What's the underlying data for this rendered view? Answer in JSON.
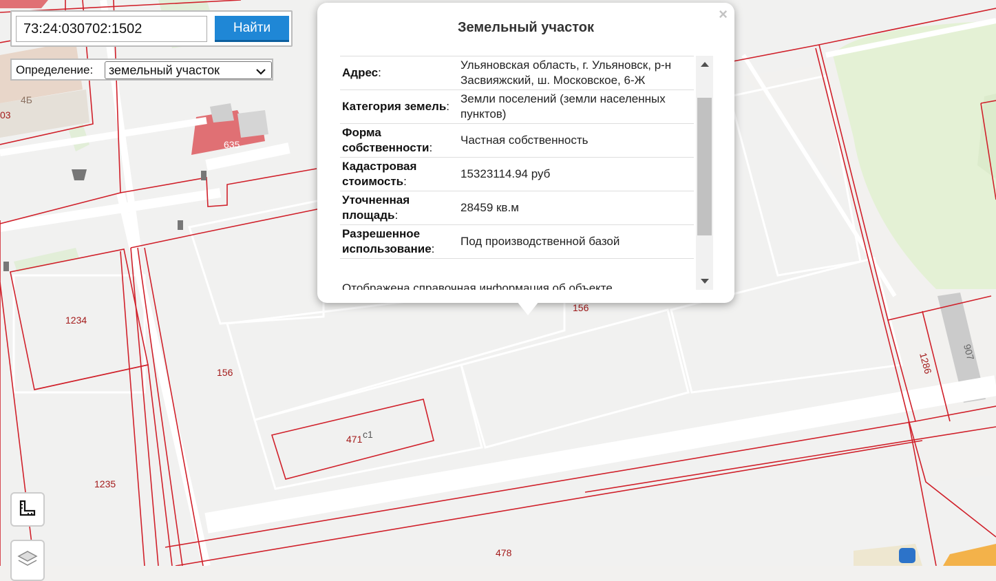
{
  "search": {
    "value": "73:24:030702:1502",
    "button_label": "Найти"
  },
  "definition": {
    "label": "Определение:",
    "selected": "земельный участок"
  },
  "map": {
    "labels": [
      "4Б",
      "03",
      "635",
      "1234",
      "156",
      "471",
      "с1",
      "1235",
      "478",
      "156",
      "1286",
      "907"
    ],
    "tools": [
      "ruler-icon",
      "layers-icon"
    ]
  },
  "popup": {
    "title": "Земельный участок",
    "close_symbol": "×",
    "properties": [
      {
        "key": "Адрес",
        "value": "Ульяновская область, г. Ульяновск, р-н Засвияжский, ш. Московское, 6-Ж"
      },
      {
        "key": "Категория земель",
        "value": "Земли поселений (земли населенных пунктов)"
      },
      {
        "key": "Форма собственности",
        "value": "Частная собственность"
      },
      {
        "key": "Кадастровая стоимость",
        "value": "15323114.94 руб"
      },
      {
        "key": "Уточненная площадь",
        "value": "28459 кв.м"
      },
      {
        "key": "Разрешенное использование",
        "value": "Под производственной базой"
      }
    ],
    "colon": ":",
    "note": "Отображена справочная информация об объекте"
  },
  "colors": {
    "parcel_border": "#d0202a",
    "building_red": "#e07074",
    "green_area": "#e3f1d4",
    "button_blue": "#1f87d6"
  }
}
